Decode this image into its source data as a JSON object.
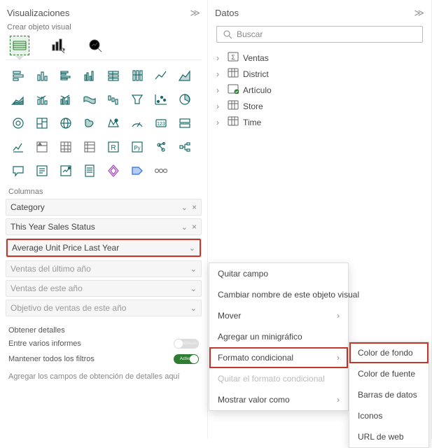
{
  "viz": {
    "title": "Visualizaciones",
    "subhead": "Crear objeto visual",
    "columns_label": "Columnas",
    "fields_active": [
      {
        "label": "Category",
        "remove": true
      },
      {
        "label": "This Year Sales Status",
        "remove": true
      },
      {
        "label": "Average Unit Price Last Year",
        "remove": false,
        "highlight": true
      }
    ],
    "fields_dim": [
      {
        "label": "Ventas del último año"
      },
      {
        "label": "Ventas de este año"
      },
      {
        "label": "Objetivo de ventas de este año"
      }
    ],
    "detail_label": "Obtener detalles",
    "cross_label": "Entre varios informes",
    "cross_toggle_text": "desactivado",
    "keep_label": "Mantener todos los filtros",
    "keep_toggle_text": "Activar",
    "drop_hint": "Agregar los campos de obtención de detalles aquí"
  },
  "data": {
    "title": "Datos",
    "search_placeholder": "Buscar",
    "tables": [
      {
        "name": "Ventas",
        "icon": "sigma"
      },
      {
        "name": "District",
        "icon": "table"
      },
      {
        "name": "Artículo",
        "icon": "check"
      },
      {
        "name": "Store",
        "icon": "table"
      },
      {
        "name": "Time",
        "icon": "table"
      }
    ]
  },
  "ctx_main": [
    {
      "label": "Quitar campo"
    },
    {
      "label": "Cambiar nombre de este objeto visual"
    },
    {
      "label": "Mover",
      "arrow": true
    },
    {
      "label": "Agregar un minigráfico"
    },
    {
      "label": "Formato condicional",
      "arrow": true,
      "hl": true
    },
    {
      "label": "Quitar el formato condicional",
      "dim": true
    },
    {
      "label": "Mostrar valor como",
      "arrow": true
    }
  ],
  "ctx_sub": [
    {
      "label": "Color de fondo",
      "hl": true
    },
    {
      "label": "Color de fuente"
    },
    {
      "label": "Barras de datos"
    },
    {
      "label": "Iconos"
    },
    {
      "label": "URL de web"
    }
  ]
}
